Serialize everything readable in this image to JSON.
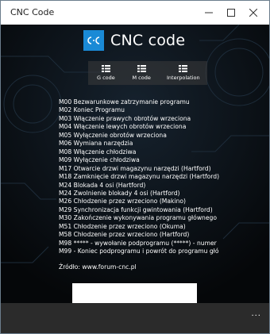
{
  "window": {
    "title": "CNC Code"
  },
  "header": {
    "logo_text": "C·C",
    "title": "CNC code"
  },
  "toolbar": {
    "buttons": [
      {
        "label": "G code",
        "icon": "grid-icon"
      },
      {
        "label": "M code",
        "icon": "grid-icon"
      },
      {
        "label": "Interpolation",
        "icon": "grid-icon"
      }
    ]
  },
  "codes": [
    "M00 Bezwarunkowe zatrzymanie programu",
    "M02 Koniec Programu",
    "M03 Włączenie prawych obrotów wrzeciona",
    "M04 Włączenie lewych obrotów wrzeciona",
    "M05 Wyłączenie obrotów wrzeciona",
    "M06 Wymiana narzędzia",
    "M08 Włączenie chłodziwa",
    "M09 Wyłączenie chłodziwa",
    "M17 Otwarcie drzwi magazynu narzędzi (Hartford)",
    "M18 Zamknięcie drzwi magazynu narzędzi (Hartford)",
    "M24 Blokada 4 osi (Hartford)",
    "M24 Zwolnienie blokady 4 osi (Hartford)",
    "M26 Chłodzenie przez wrzeciono (Makino)",
    "M29 Synchronizacja funkcji gwintowania (Hartford)",
    "M30 Zakończenie wykonywania programu głównego",
    "M51 Chłodzenie przez wrzeciono (Okuma)",
    "M58 Chłodzenie przez wrzeciono (Hartford)",
    "M98 ***** - wywołanie podprogramu (*****) - numer",
    "M99 - Koniec podprogramu i powrót do programu głó"
  ],
  "source": "Źródło: www.forum-cnc.pl",
  "appbar": {
    "more_label": "..."
  },
  "colors": {
    "accent": "#1a8ad6",
    "background": "#050709",
    "appbar": "#2b2b2b"
  }
}
